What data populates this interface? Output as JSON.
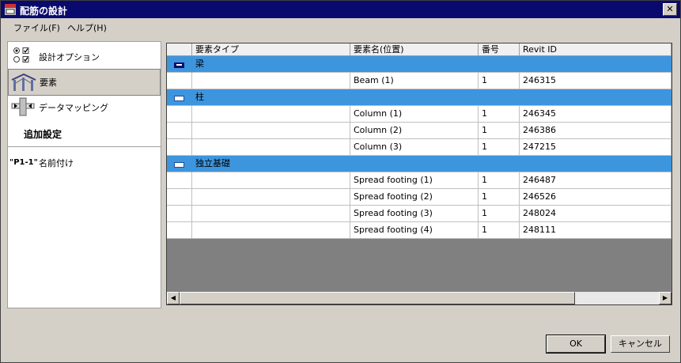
{
  "window": {
    "title": "配筋の設計",
    "close": "✕"
  },
  "menu": {
    "items": [
      {
        "label": "ファイル(F)"
      },
      {
        "label": "ヘルプ(H)"
      }
    ]
  },
  "nav": {
    "items": [
      {
        "label": "設計オプション",
        "icon": "design-options-icon"
      },
      {
        "label": "要素",
        "icon": "frame-elements-icon",
        "selected": true
      },
      {
        "label": "データマッピング",
        "icon": "data-mapping-icon"
      }
    ],
    "section_title": "追加設定",
    "extra": [
      {
        "label": "名前付け",
        "prefix": "\"P1-1\"",
        "icon": "naming-icon"
      }
    ]
  },
  "grid": {
    "columns": [
      "要素タイプ",
      "要素名(位置)",
      "番号",
      "Revit ID"
    ],
    "groups": [
      {
        "name": "梁",
        "rows": [
          {
            "name": "Beam (1)",
            "num": "1",
            "id": "246315"
          }
        ]
      },
      {
        "name": "柱",
        "rows": [
          {
            "name": "Column (1)",
            "num": "1",
            "id": "246345"
          },
          {
            "name": "Column (2)",
            "num": "1",
            "id": "246386"
          },
          {
            "name": "Column (3)",
            "num": "1",
            "id": "247215"
          }
        ]
      },
      {
        "name": "独立基礎",
        "rows": [
          {
            "name": "Spread footing (1)",
            "num": "1",
            "id": "246487"
          },
          {
            "name": "Spread footing (2)",
            "num": "1",
            "id": "246526"
          },
          {
            "name": "Spread footing (3)",
            "num": "1",
            "id": "248024"
          },
          {
            "name": "Spread footing (4)",
            "num": "1",
            "id": "248111"
          }
        ]
      }
    ]
  },
  "buttons": {
    "ok": "OK",
    "cancel": "キャンセル"
  },
  "colors": {
    "title_bar": "#0a0a6e",
    "group_row": "#3d95de",
    "grid_bg": "#808080"
  }
}
